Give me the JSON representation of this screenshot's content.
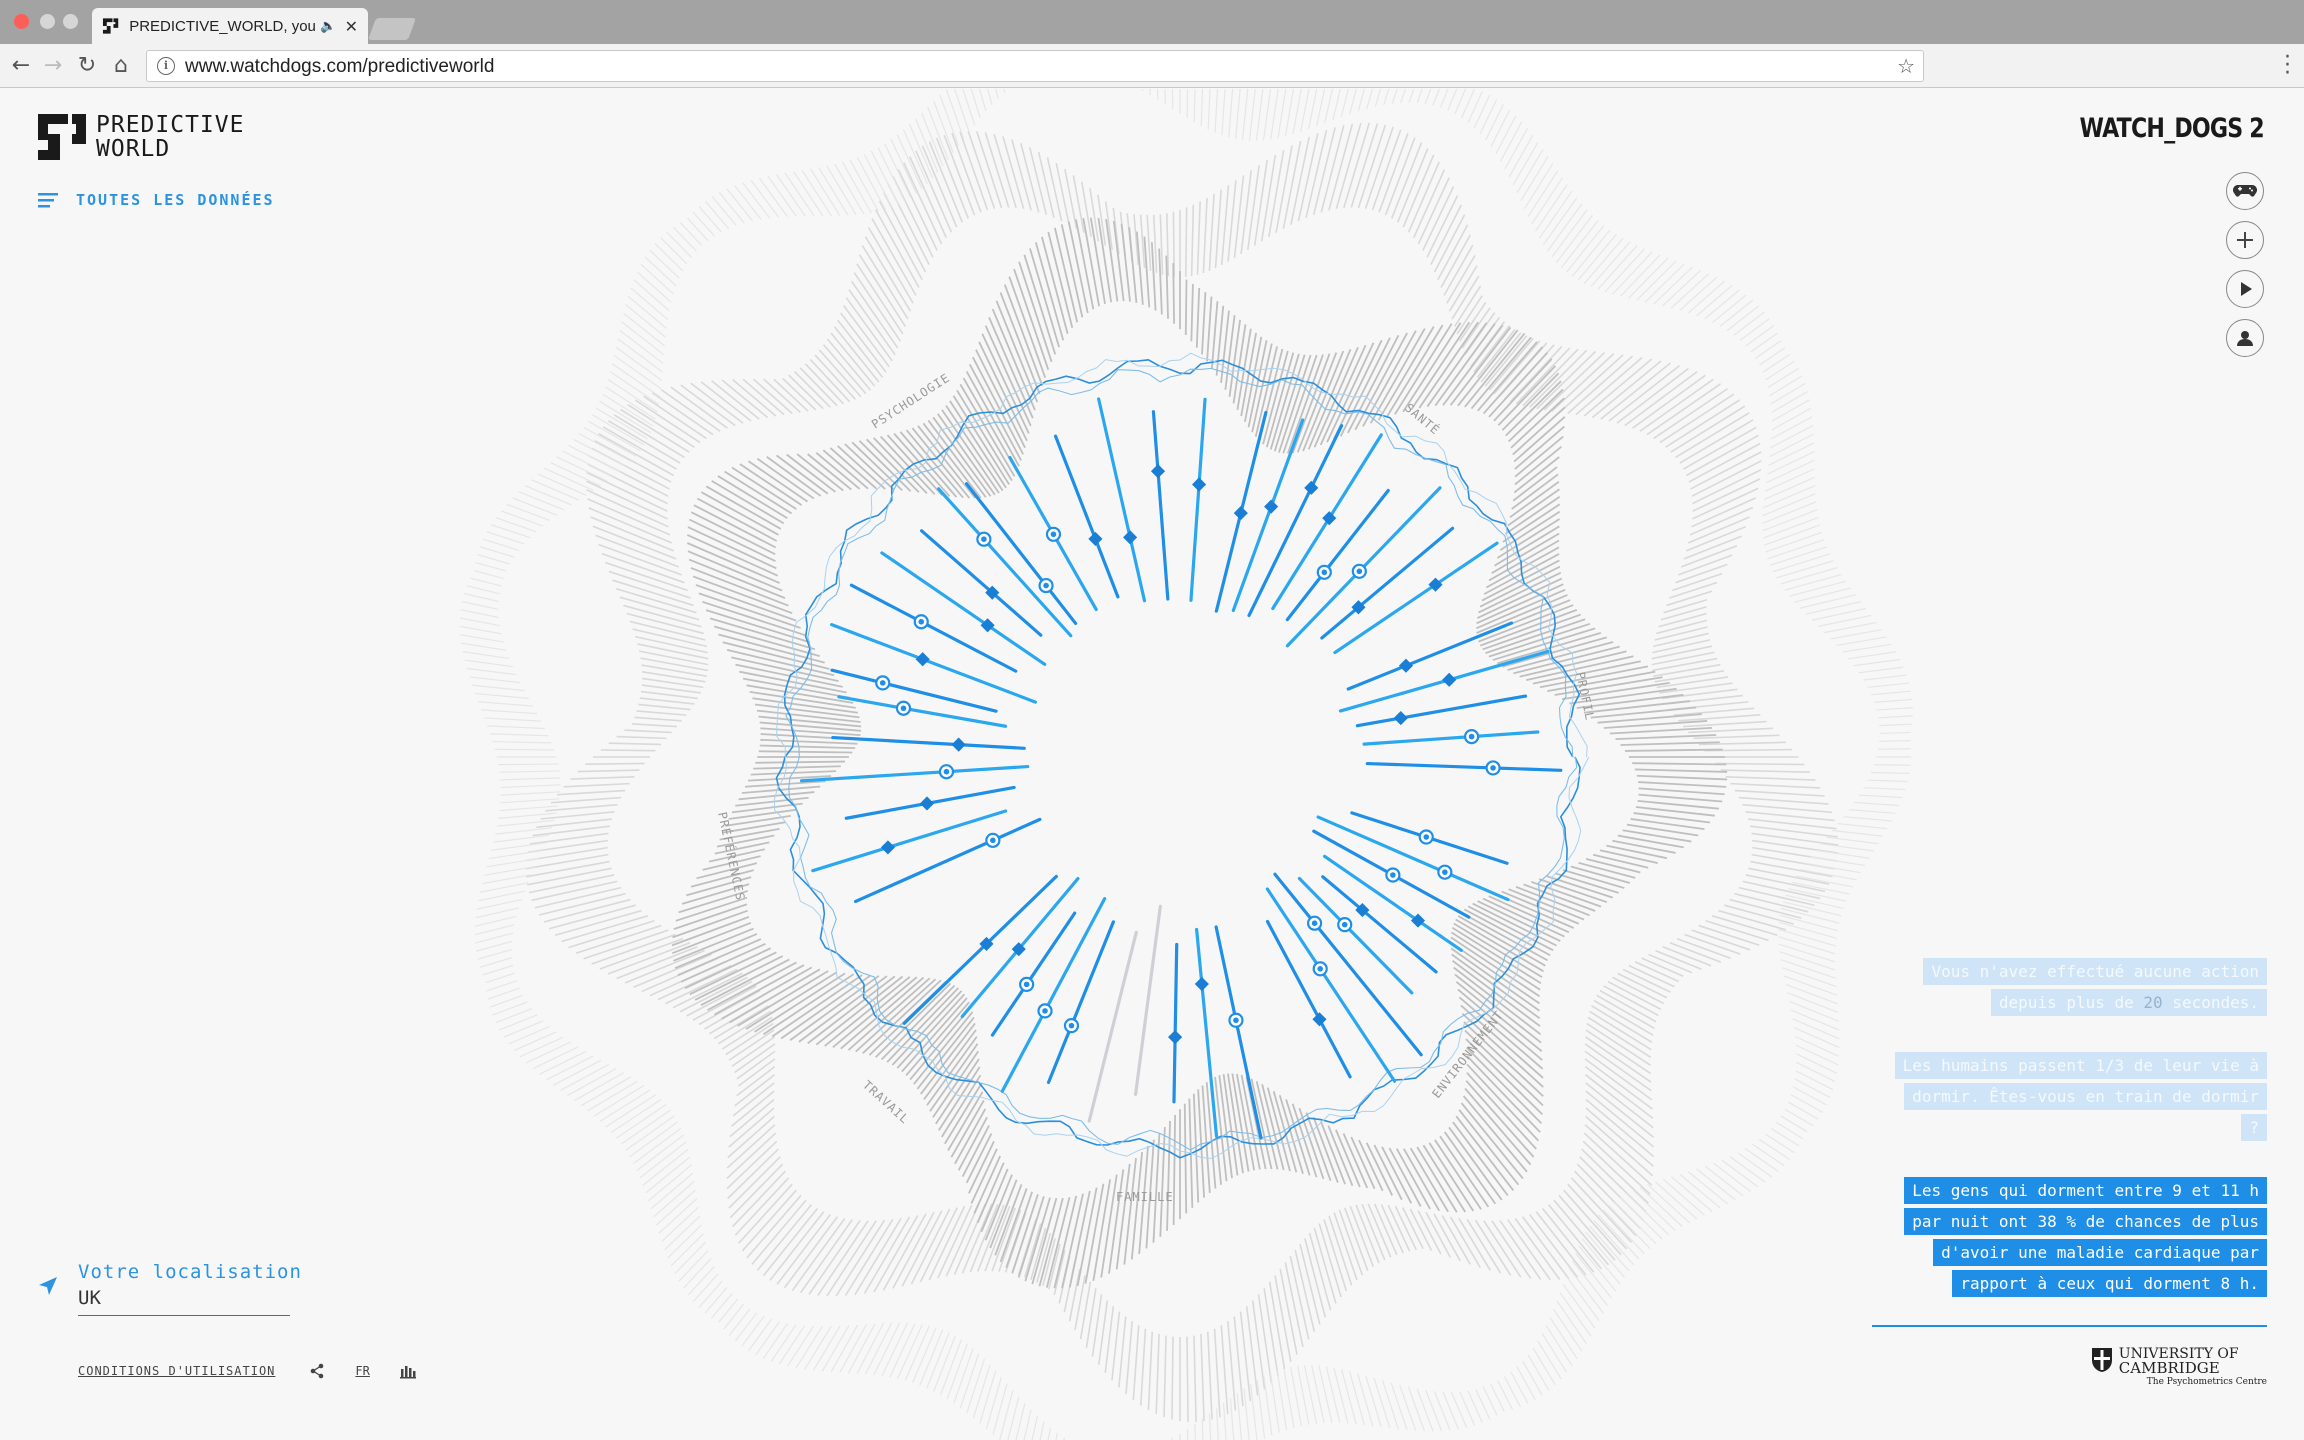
{
  "browser": {
    "tab_title": "PREDICTIVE_WORLD, your f",
    "url": "www.watchdogs.com/predictiveworld"
  },
  "header": {
    "logo_line1": "PREDICTIVE",
    "logo_line2": "WORLD",
    "menu_label": "TOUTES LES DONNÉES",
    "brand": "WATCH_DOGS 2"
  },
  "side_buttons": [
    {
      "icon": "gamepad-icon"
    },
    {
      "icon": "plus-icon"
    },
    {
      "icon": "play-icon"
    },
    {
      "icon": "user-icon"
    }
  ],
  "categories": {
    "psychologie": "PSYCHOLOGIE",
    "sante": "SANTÉ",
    "profil": "PROFIL",
    "environnement": "ENVIRONNEMENT",
    "famille": "FAMILLE",
    "travail": "TRAVAIL",
    "preferences": "PRÉFÉRENCES"
  },
  "location": {
    "label": "Votre localisation",
    "value": "UK"
  },
  "footer": {
    "terms": "CONDITIONS D'UTILISATION",
    "lang": "FR"
  },
  "messages": {
    "idle_1": "Vous n'avez effectué aucune action",
    "idle_2a": "depuis plus de ",
    "idle_seconds": "20",
    "idle_2b": " secondes.",
    "sleep_1": "Les humains passent 1/3 de leur vie à",
    "sleep_2": "dormir. Êtes-vous en train de dormir",
    "sleep_3": "?",
    "fact_1": "Les gens qui dorment entre 9 et 11 h",
    "fact_2": "par nuit ont 38 % de chances de plus",
    "fact_3": "d'avoir une maladie cardiaque par",
    "fact_4": "rapport à ceux qui dorment 8 h."
  },
  "credit": {
    "line1": "UNIVERSITY OF",
    "line2": "CAMBRIDGE",
    "line3": "The Psychometrics Centre"
  },
  "colors": {
    "accent": "#1f8ee6",
    "accent_light": "#2aa7ee",
    "ring_gray": "#bdbdbd"
  }
}
